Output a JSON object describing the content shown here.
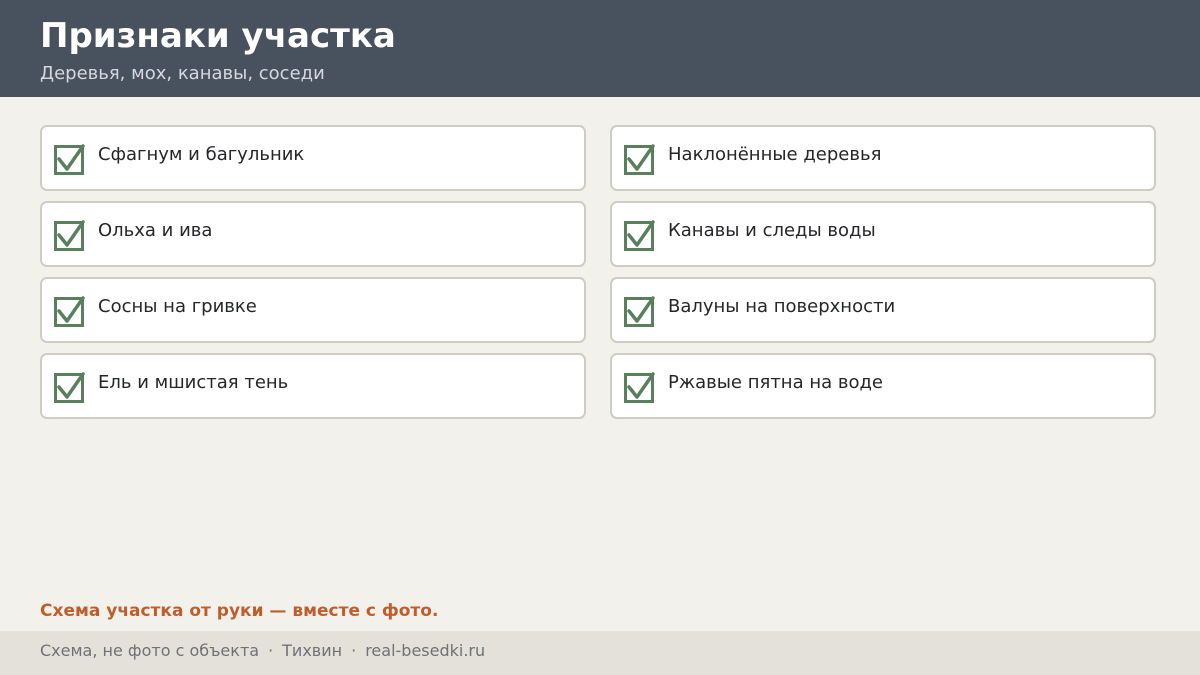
{
  "header": {
    "title": "Признаки участка",
    "subtitle": "Деревья, мох, канавы, соседи"
  },
  "checklist": {
    "items": [
      {
        "label": "Сфагнум и багульник",
        "checked": true
      },
      {
        "label": "Наклонённые деревья",
        "checked": true
      },
      {
        "label": "Ольха и ива",
        "checked": true
      },
      {
        "label": "Канавы и следы воды",
        "checked": true
      },
      {
        "label": "Сосны на гривке",
        "checked": true
      },
      {
        "label": "Валуны на поверхности",
        "checked": true
      },
      {
        "label": "Ель и мшистая тень",
        "checked": true
      },
      {
        "label": "Ржавые пятна на воде",
        "checked": true
      }
    ]
  },
  "note": "Схема участка от руки — вместе с фото.",
  "footer": {
    "disclaimer": "Схема, не фото с объекта",
    "separator": "·",
    "city": "Тихвин",
    "site": "real-besedki.ru"
  },
  "colors": {
    "header_bg": "#48515e",
    "page_bg": "#f3f1ec",
    "check_green": "#5a7f5d",
    "accent_orange": "#bf5e2c",
    "footer_bg": "#e4e1db"
  },
  "icons": {
    "checkbox": "checkmark-icon"
  }
}
